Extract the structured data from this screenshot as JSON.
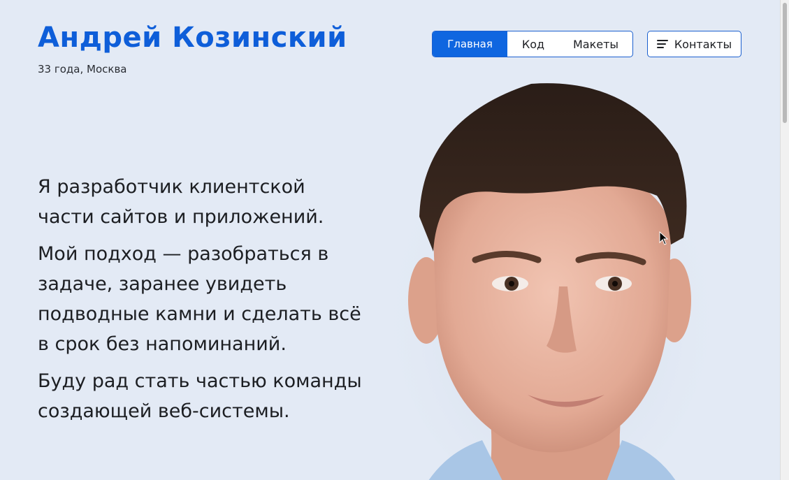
{
  "header": {
    "name": "Андрей Козинский",
    "subtitle": "33 года, Москва"
  },
  "nav": {
    "tabs": [
      {
        "label": "Главная",
        "active": true
      },
      {
        "label": "Код",
        "active": false
      },
      {
        "label": "Макеты",
        "active": false
      }
    ],
    "contacts_label": "Контакты",
    "contacts_icon": "menu-icon"
  },
  "intro": {
    "paragraphs": [
      "Я разработчик клиентской части сайтов и приложений.",
      "Мой подход — разобраться в задаче, заранее увидеть подводные камни и сделать всё в срок без напоминаний.",
      "Буду рад стать частью команды создающей веб-системы."
    ]
  },
  "colors": {
    "accent": "#0f66e0",
    "background": "#e3eaf5",
    "text": "#1c1e22"
  }
}
